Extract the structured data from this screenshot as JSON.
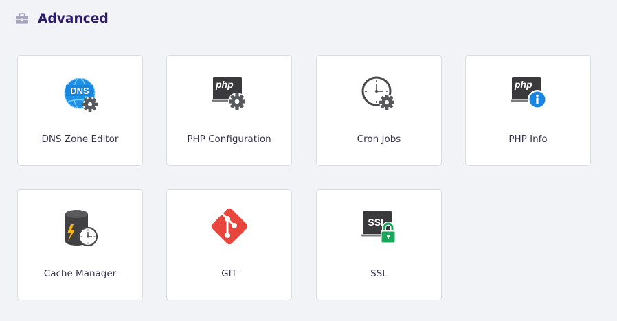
{
  "section": {
    "title": "Advanced",
    "icon": "toolbox-icon"
  },
  "tiles": [
    {
      "label": "DNS Zone Editor",
      "icon": "dns-gear-icon",
      "icon_text": "DNS"
    },
    {
      "label": "PHP Configuration",
      "icon": "php-gear-icon",
      "icon_text": "php"
    },
    {
      "label": "Cron Jobs",
      "icon": "clock-gear-icon"
    },
    {
      "label": "PHP Info",
      "icon": "php-info-icon",
      "icon_text": "php"
    },
    {
      "label": "Cache Manager",
      "icon": "database-clock-icon"
    },
    {
      "label": "GIT",
      "icon": "git-icon"
    },
    {
      "label": "SSL",
      "icon": "ssl-lock-icon",
      "icon_text": "SSL"
    }
  ],
  "colors": {
    "background": "#f2f3f6",
    "title": "#2f1c6a",
    "dns_blue": "#1e90e6",
    "git_red": "#e8453c",
    "ssl_green": "#19a75a",
    "info_blue": "#1a84e3",
    "icon_dark": "#3a3a3c",
    "gear_gray": "#58595c"
  }
}
